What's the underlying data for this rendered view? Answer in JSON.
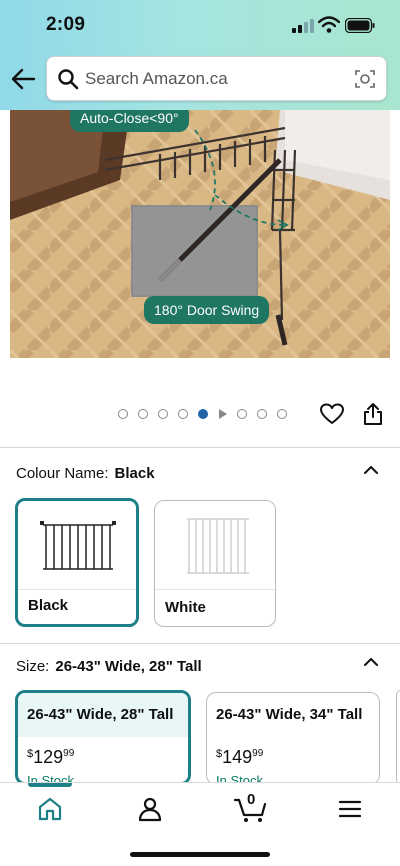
{
  "status_bar": {
    "time": "2:09"
  },
  "search": {
    "placeholder": "Search Amazon.ca"
  },
  "hero": {
    "badge_top": "Auto-Close<90°",
    "badge_bottom": "180° Door Swing",
    "dot_count": 9,
    "active_dot": 4,
    "video_dot": 5
  },
  "colour": {
    "label": "Colour Name:",
    "selected": "Black",
    "options": [
      {
        "label": "Black"
      },
      {
        "label": "White"
      }
    ]
  },
  "size": {
    "label": "Size:",
    "selected": "26-43\" Wide, 28\" Tall",
    "options": [
      {
        "title": "26-43\" Wide, 28\" Tall",
        "currency": "$",
        "price_whole": "129",
        "price_cents": "99",
        "stock": "In Stock"
      },
      {
        "title": "26-43\" Wide, 34\" Tall",
        "currency": "$",
        "price_whole": "149",
        "price_cents": "99",
        "stock": "In Stock"
      }
    ]
  },
  "nav": {
    "cart_count": "0"
  },
  "colors": {
    "accent": "#1e7f86",
    "badge": "#1f7663",
    "stock": "#067d62"
  }
}
